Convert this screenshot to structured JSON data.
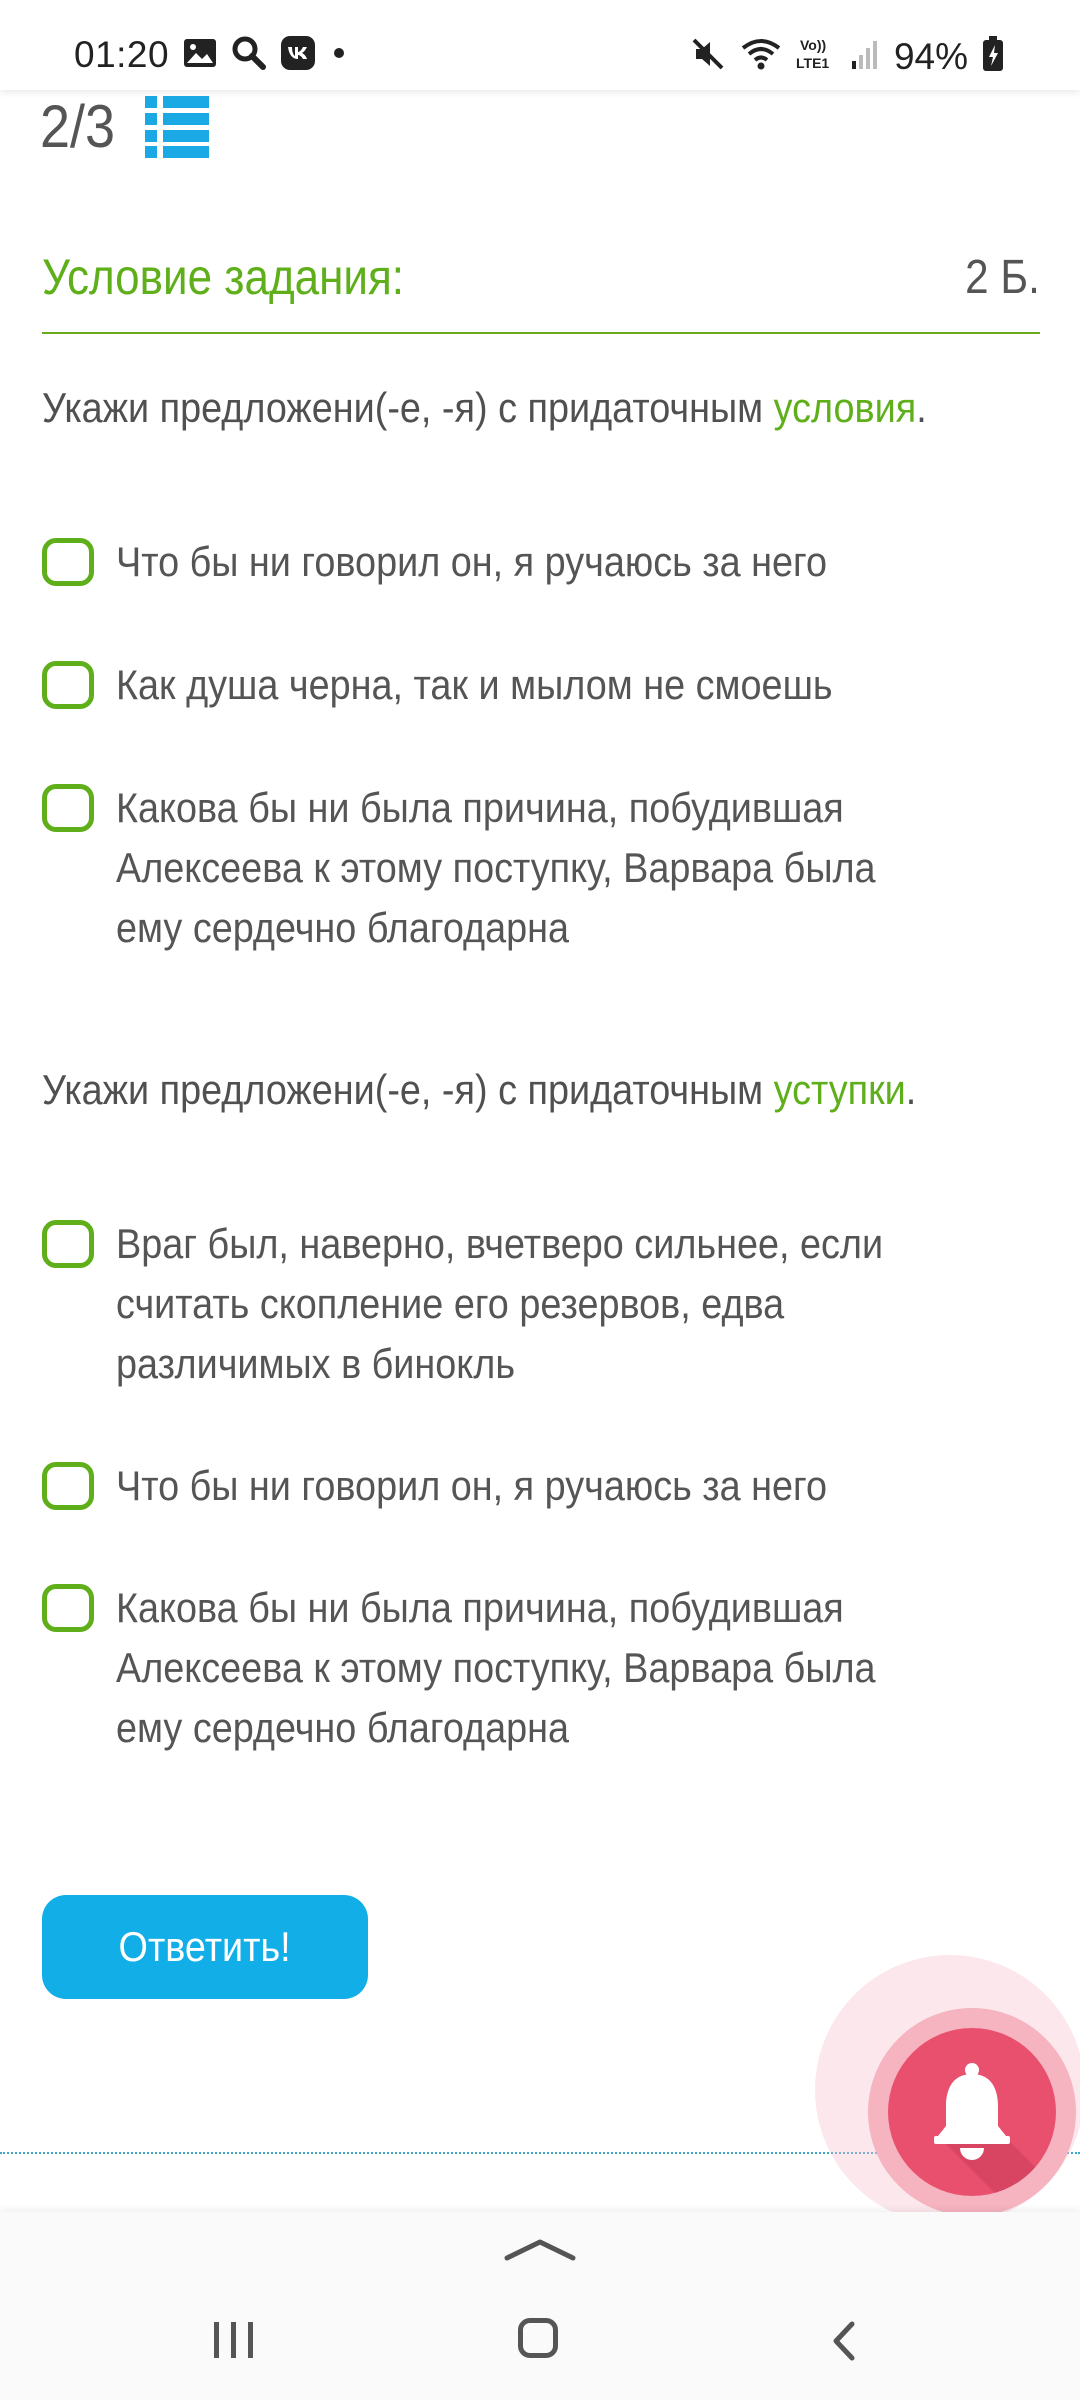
{
  "status_bar": {
    "time": "01:20",
    "battery": "94%",
    "left_icons": [
      "image-icon",
      "search-icon",
      "vk-icon",
      "dot-icon"
    ],
    "right_icons": [
      "mute-icon",
      "wifi-icon",
      "volte-icon",
      "signal-icon",
      "battery-icon"
    ],
    "volte_label": "Vo))\nLTE1"
  },
  "progress": {
    "counter": "2/3",
    "icon": "list-icon"
  },
  "task": {
    "title": "Условие задания:",
    "points": "2 Б."
  },
  "questions": [
    {
      "prefix": "Укажи предложени(-е, -я) с придаточным ",
      "accent": "условия",
      "suffix": ".",
      "options": [
        "Что бы ни говорил он, я ручаюсь за него",
        "Как душа черна, так и мылом не смоешь",
        "Какова бы ни была причина, побудившая Алексеева к этому поступку, Варвара была ему сердечно благодарна"
      ]
    },
    {
      "prefix": "Укажи предложени(-е, -я) с придаточным ",
      "accent": "уступки",
      "suffix": ".",
      "options": [
        "Враг был, наверно, вчетверо сильнее, если считать скопление его резервов, едва различимых в бинокль",
        "Что бы ни говорил он, я ручаюсь за него",
        "Какова бы ни была причина, побудившая Алексеева к этому поступку, Варвара была ему сердечно благодарна"
      ]
    }
  ],
  "answer_button": "Ответить!",
  "colors": {
    "accent_green": "#5faf1b",
    "button_blue": "#12aee8",
    "bell_pink": "#e9506e"
  },
  "nav_bar": {
    "icons": [
      "swipe-up-handle-icon",
      "recent-apps-icon",
      "home-icon",
      "back-icon"
    ]
  }
}
